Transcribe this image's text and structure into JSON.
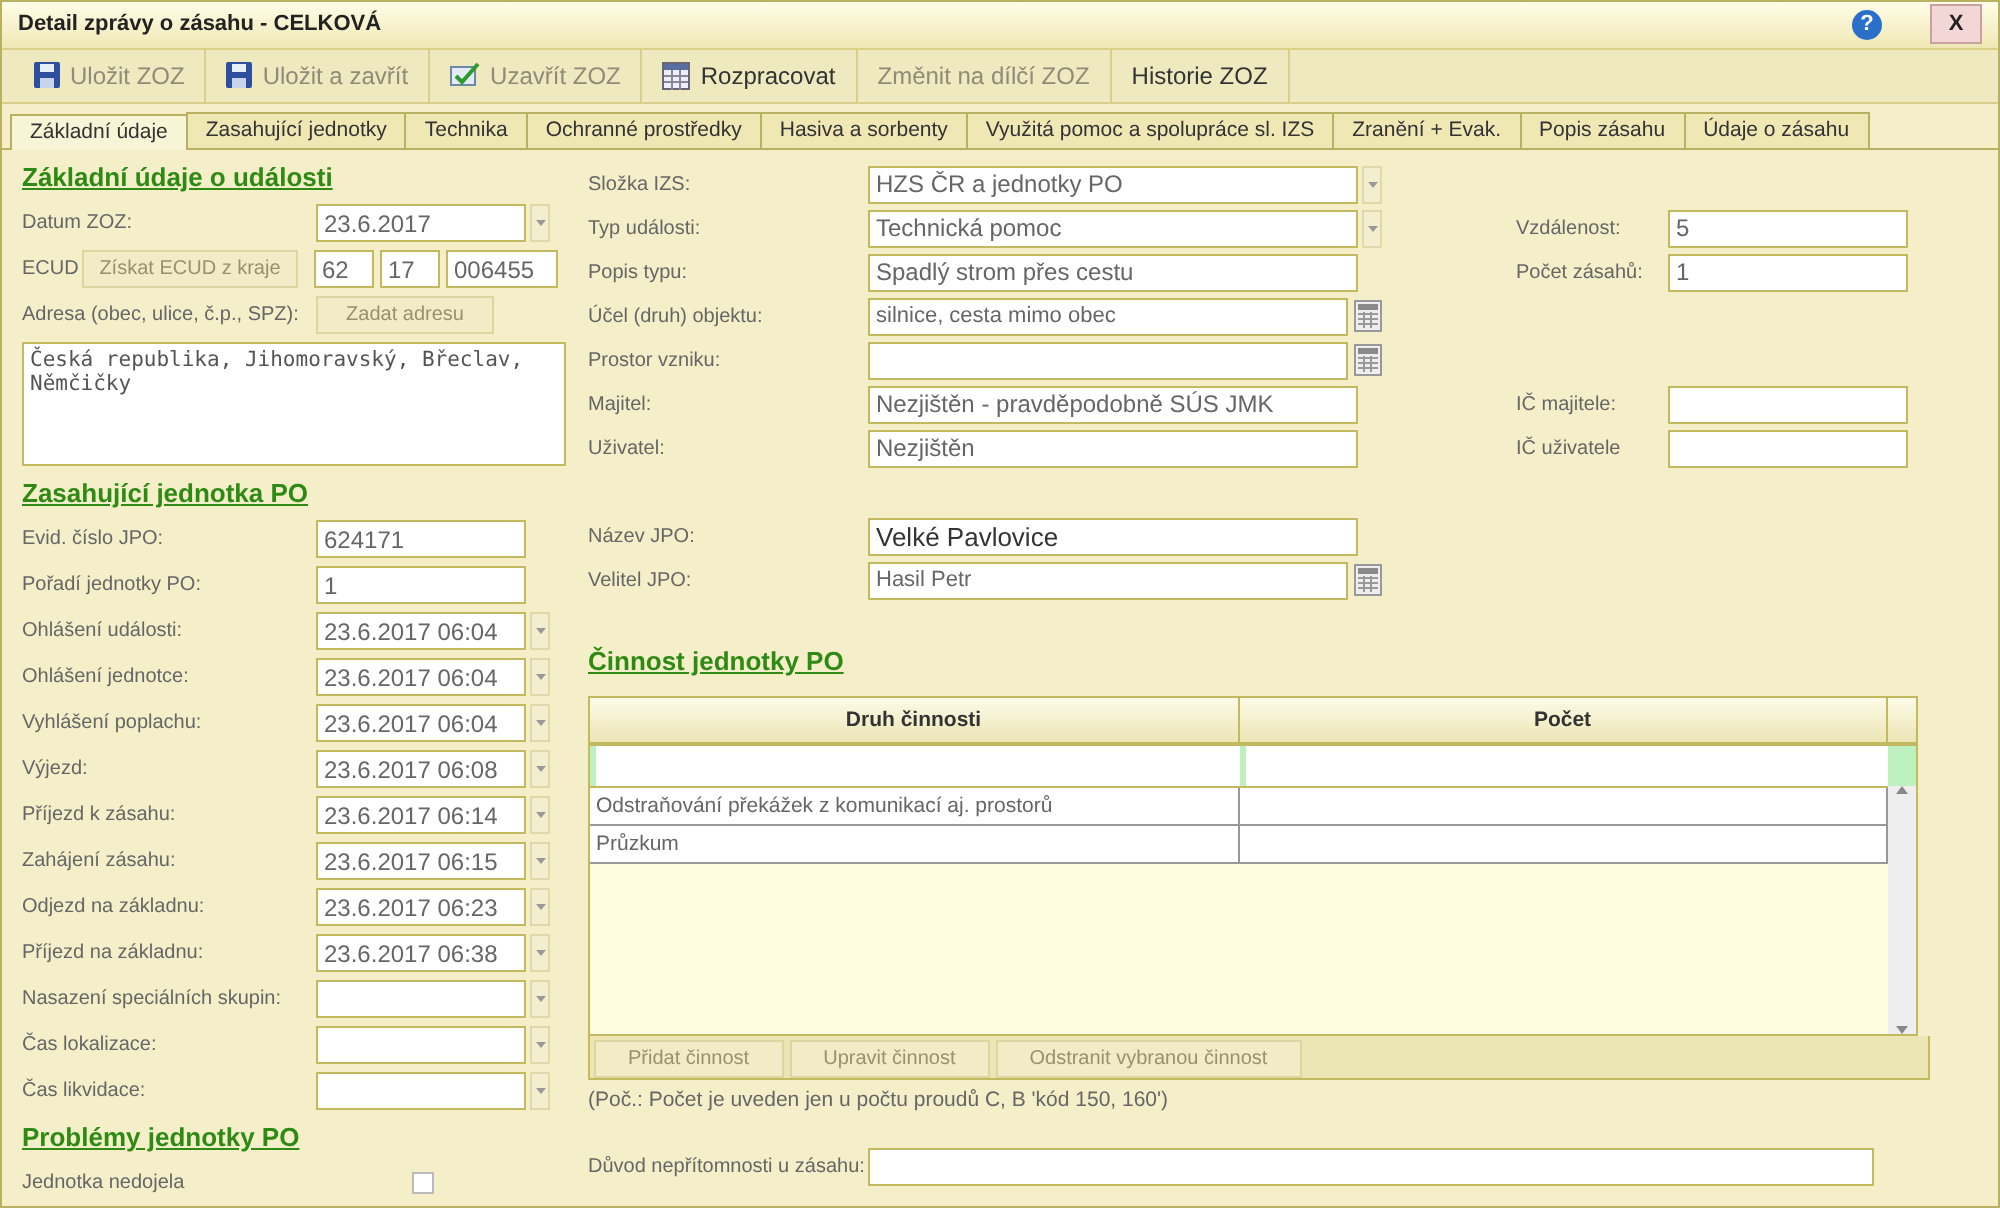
{
  "window": {
    "title": "Detail zprávy o zásahu - CELKOVÁ",
    "help": "?",
    "close": "X"
  },
  "toolbar": [
    {
      "label": "Uložit ZOZ",
      "disabled": true
    },
    {
      "label": "Uložit a zavřít",
      "disabled": true
    },
    {
      "label": "Uzavřít ZOZ",
      "disabled": true
    },
    {
      "label": "Rozpracovat",
      "disabled": false
    },
    {
      "label": "Změnit na dílčí ZOZ",
      "disabled": true
    },
    {
      "label": "Historie ZOZ",
      "disabled": false
    }
  ],
  "tabs": [
    {
      "label": "Základní údaje",
      "selected": true
    },
    {
      "label": "Zasahující jednotky",
      "selected": false
    },
    {
      "label": "Technika",
      "selected": false
    },
    {
      "label": "Ochranné prostředky",
      "selected": false
    },
    {
      "label": "Hasiva a sorbenty",
      "selected": false
    },
    {
      "label": "Využitá pomoc a spolupráce sl. IZS",
      "selected": false
    },
    {
      "label": "Zranění + Evak.",
      "selected": false
    },
    {
      "label": "Popis zásahu",
      "selected": false
    },
    {
      "label": "Údaje o zásahu",
      "selected": false
    }
  ],
  "event": {
    "heading": "Základní údaje o události",
    "date": {
      "label": "Datum ZOZ:",
      "value": "23.6.2017"
    },
    "ecud": {
      "label": "ECUD",
      "button": {
        "label": "Získat ECUD z kraje",
        "disabled": true
      },
      "parts": [
        "62",
        "17",
        "006455"
      ]
    },
    "address": {
      "label": "Adresa (obec, ulice, č.p., SPZ):",
      "button": {
        "label": "Zadat adresu",
        "disabled": true
      },
      "value": "Česká republika, Jihomoravský, Břeclav, Němčičky"
    }
  },
  "unit": {
    "heading": "Zasahující jednotka PO",
    "fields": [
      {
        "label": "Evid. číslo JPO:",
        "value": "624171",
        "kind": "text"
      },
      {
        "label": "Pořadí jednotky PO:",
        "value": "1",
        "kind": "text"
      },
      {
        "label": "Ohlášení události:",
        "value": "23.6.2017 06:04",
        "kind": "datetime"
      },
      {
        "label": "Ohlášení jednotce:",
        "value": "23.6.2017 06:04",
        "kind": "datetime"
      },
      {
        "label": "Vyhlášení poplachu:",
        "value": "23.6.2017 06:04",
        "kind": "datetime"
      },
      {
        "label": "Výjezd:",
        "value": "23.6.2017 06:08",
        "kind": "datetime"
      },
      {
        "label": "Příjezd k zásahu:",
        "value": "23.6.2017 06:14",
        "kind": "datetime"
      },
      {
        "label": "Zahájení zásahu:",
        "value": "23.6.2017 06:15",
        "kind": "datetime"
      },
      {
        "label": "Odjezd na základnu:",
        "value": "23.6.2017 06:23",
        "kind": "datetime"
      },
      {
        "label": "Příjezd na základnu:",
        "value": "23.6.2017 06:38",
        "kind": "datetime"
      },
      {
        "label": "Nasazení speciálních skupin:",
        "kind": "datetime"
      },
      {
        "label": "Čas lokalizace:",
        "kind": "datetime"
      },
      {
        "label": "Čas likvidace:",
        "kind": "datetime"
      }
    ]
  },
  "problems": {
    "heading": "Problémy jednotky PO",
    "not_departed": {
      "label": "Jednotka nedojela",
      "checked": false
    }
  },
  "details": [
    {
      "label": "Složka IZS:",
      "value": "HZS ČR a jednotky PO",
      "kind": "dropdown"
    },
    {
      "label": "Typ události:",
      "value": "Technická pomoc",
      "kind": "dropdown",
      "side": {
        "label": "Vzdálenost:",
        "value": "5"
      }
    },
    {
      "label": "Popis typu:",
      "value": "Spadlý strom přes cestu",
      "kind": "text",
      "side": {
        "label": "Počet zásahů:",
        "value": "1"
      }
    },
    {
      "label": "Účel (druh) objektu:",
      "value": "silnice, cesta mimo obec",
      "kind": "picker"
    },
    {
      "label": "Prostor vzniku:",
      "kind": "picker"
    },
    {
      "label": "Majitel:",
      "value": "Nezjištěn - pravděpodobně SÚS JMK",
      "kind": "text",
      "side": {
        "label": "IČ majitele:"
      }
    },
    {
      "label": "Uživatel:",
      "value": "Nezjištěn",
      "kind": "text",
      "side": {
        "label": "IČ uživatele"
      }
    }
  ],
  "jpo": [
    {
      "label": "Název JPO:",
      "value": "Velké Pavlovice",
      "kind": "text"
    },
    {
      "label": "Velitel JPO:",
      "value": "Hasil Petr",
      "kind": "picker"
    }
  ],
  "activities": {
    "heading": "Činnost jednotky PO",
    "columns": [
      "Druh činnosti",
      "Počet"
    ],
    "rows": [
      {
        "activity": "Odstraňování překážek z komunikací aj. prostorů"
      },
      {
        "activity": "Průzkum"
      }
    ],
    "buttons": [
      {
        "label": "Přidat činnost",
        "disabled": true
      },
      {
        "label": "Upravit činnost",
        "disabled": true
      },
      {
        "label": "Odstranit vybranou činnost",
        "disabled": true
      }
    ],
    "note": "(Poč.: Počet je uveden jen u počtu proudů C, B 'kód 150, 160')"
  },
  "absence": {
    "label": "Důvod nepřítomnosti u zásahu:"
  }
}
